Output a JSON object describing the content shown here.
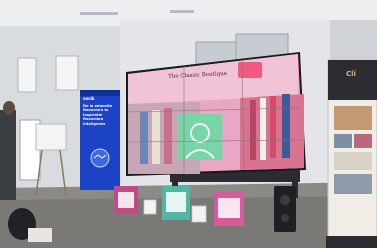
{
  "scene": {
    "description": "",
    "screen_title": "The Classic Boutique",
    "screen_subtitle": "",
    "left_banner_brand": "essik",
    "left_banner_text": "De la educatie financiara la inspiratie financiara inteligenta",
    "right_banner_brand": "Cli"
  },
  "colors": {
    "wall": "#d9dcdf",
    "ceiling": "#eceef0",
    "floor": "#8c8a86",
    "banner_blue": "#1c43c6",
    "screen_pink": "#e8a7c4",
    "screen_green": "#78d5a8",
    "stand_dark": "#2a2c31"
  }
}
